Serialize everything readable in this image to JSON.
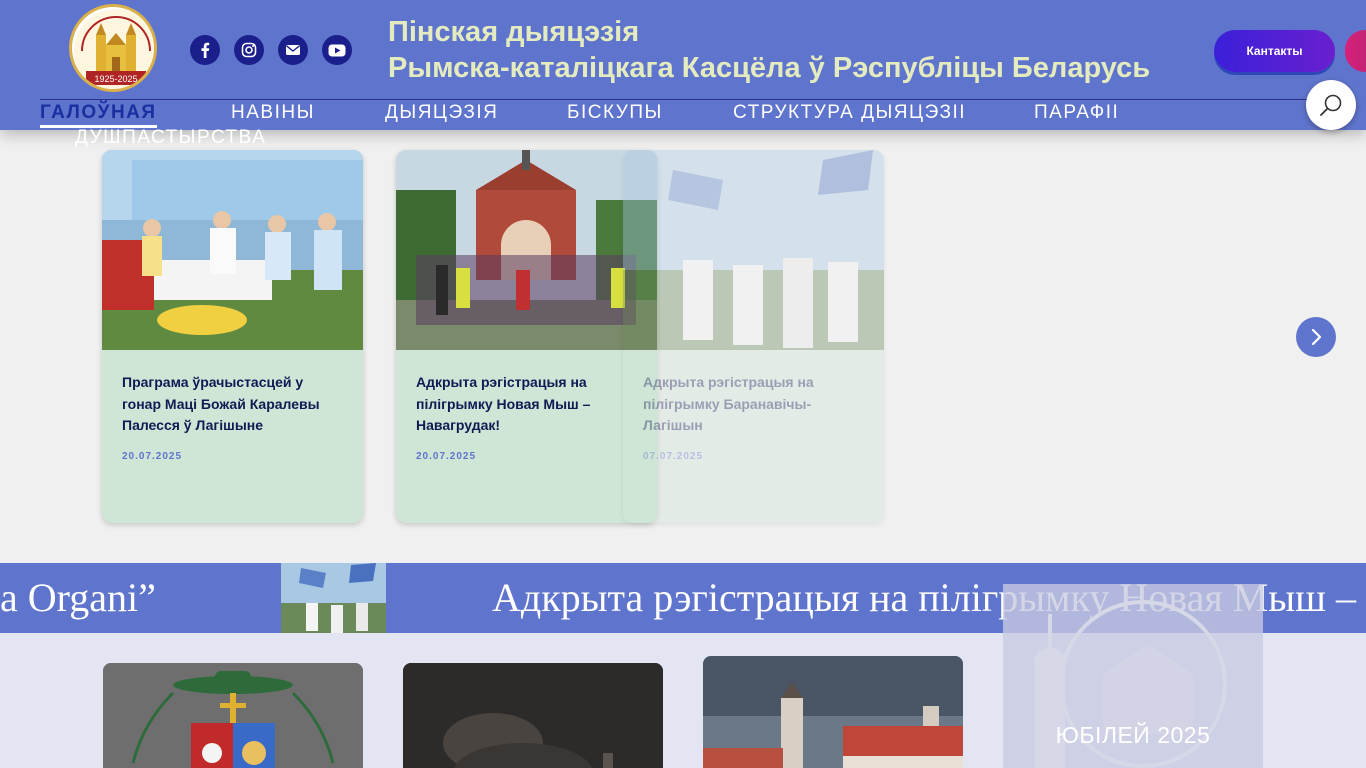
{
  "header": {
    "title_line1": "Пінская дыяцэзія",
    "title_line2": "Рымска-каталіцкага Касцёла ў Рэспубліцы Беларусь",
    "contacts_label": "Кантакты",
    "social": [
      "facebook-icon",
      "instagram-icon",
      "mail-icon",
      "youtube-icon"
    ]
  },
  "nav": {
    "items": [
      "ГАЛОЎНАЯ",
      "НАВІНЫ",
      "ДЫЯЦЭЗІЯ",
      "БІСКУПЫ",
      "СТРУКТУРА ДЫЯЦЭЗІІ",
      "ПАРАФІІ",
      "ДУШПАСТЫРСТВА"
    ],
    "active": "ГАЛОЎНАЯ"
  },
  "news": [
    {
      "title": "Праграма ўрачыстасцей у гонар Маці Божай Каралевы Палесся ў Лагішыне",
      "date": "20.07.2025"
    },
    {
      "title": "Адкрыта рэгістрацыя на пілігрымку Новая Мыш – Навагрудак!",
      "date": "20.07.2025"
    },
    {
      "title": "Адкрыта рэгістрацыя на пілігрымку Баранавічы-Лагішын",
      "date": "07.07.2025"
    }
  ],
  "ticker": {
    "left_fragment": "a Organi”",
    "right_text": "Адкрыта рэгістрацыя на пілігрымку Новая Мыш – Навагрудак!"
  },
  "jubilee": {
    "label": "ЮБІЛЕЙ 2025"
  },
  "colors": {
    "header": "#5f74cc",
    "card": "#cfe5d6",
    "title": "#e3ebbf",
    "accent": "#1a1f8c"
  }
}
